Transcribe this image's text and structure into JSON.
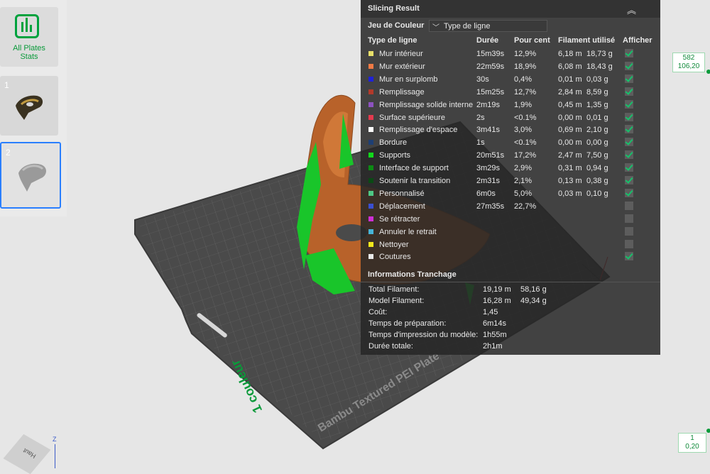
{
  "sidebar": {
    "stats_label_line1": "All Plates",
    "stats_label_line2": "Stats",
    "plates": [
      {
        "number": "1"
      },
      {
        "number": "2"
      }
    ]
  },
  "scene": {
    "plate_text": "Bambu Textured PEI Plate",
    "filament_label": "1 couleur",
    "axis_z": "Z",
    "axis_view": "Haut"
  },
  "panel": {
    "title": "Slicing Result",
    "color_scheme_label": "Jeu de Couleur",
    "color_scheme_value": "Type de ligne",
    "headers": {
      "type": "Type de ligne",
      "duration": "Durée",
      "percent": "Pour cent",
      "filament": "Filament utilisé",
      "show": "Afficher"
    },
    "rows": [
      {
        "name": "Mur intérieur",
        "color": "#e8e06a",
        "dur": "15m39s",
        "pct": "12,9%",
        "len": "6,18 m",
        "wt": "18,73 g",
        "shown": true
      },
      {
        "name": "Mur extérieur",
        "color": "#f07a45",
        "dur": "22m59s",
        "pct": "18,9%",
        "len": "6,08 m",
        "wt": "18,43 g",
        "shown": true
      },
      {
        "name": "Mur en surplomb",
        "color": "#1f22d8",
        "dur": "30s",
        "pct": "0,4%",
        "len": "0,01 m",
        "wt": "0,03 g",
        "shown": true
      },
      {
        "name": "Remplissage",
        "color": "#b23a2a",
        "dur": "15m25s",
        "pct": "12,7%",
        "len": "2,84 m",
        "wt": "8,59 g",
        "shown": true
      },
      {
        "name": "Remplissage solide interne",
        "color": "#8d52c0",
        "dur": "2m19s",
        "pct": "1,9%",
        "len": "0,45 m",
        "wt": "1,35 g",
        "shown": true
      },
      {
        "name": "Surface supérieure",
        "color": "#e43a4e",
        "dur": "2s",
        "pct": "<0.1%",
        "len": "0,00 m",
        "wt": "0,01 g",
        "shown": true
      },
      {
        "name": "Remplissage d'espace",
        "color": "#ffffff",
        "dur": "3m41s",
        "pct": "3,0%",
        "len": "0,69 m",
        "wt": "2,10 g",
        "shown": true
      },
      {
        "name": "Bordure",
        "color": "#1e3f74",
        "dur": "1s",
        "pct": "<0.1%",
        "len": "0,00 m",
        "wt": "0,00 g",
        "shown": true
      },
      {
        "name": "Supports",
        "color": "#11d81b",
        "dur": "20m51s",
        "pct": "17,2%",
        "len": "2,47 m",
        "wt": "7,50 g",
        "shown": true
      },
      {
        "name": "Interface de support",
        "color": "#0c8a14",
        "dur": "3m29s",
        "pct": "2,9%",
        "len": "0,31 m",
        "wt": "0,94 g",
        "shown": true
      },
      {
        "name": "Soutenir la transition",
        "color": "#0a4a14",
        "dur": "2m31s",
        "pct": "2,1%",
        "len": "0,13 m",
        "wt": "0,38 g",
        "shown": true
      },
      {
        "name": "Personnalisé",
        "color": "#4ec884",
        "dur": "6m0s",
        "pct": "5,0%",
        "len": "0,03 m",
        "wt": "0,10 g",
        "shown": true
      },
      {
        "name": "Déplacement",
        "color": "#3a4fd0",
        "dur": "27m35s",
        "pct": "22,7%",
        "len": "",
        "wt": "",
        "shown": false
      },
      {
        "name": "Se rétracter",
        "color": "#cf2fd6",
        "dur": "",
        "pct": "",
        "len": "",
        "wt": "",
        "shown": false
      },
      {
        "name": "Annuler le retrait",
        "color": "#46b4d8",
        "dur": "",
        "pct": "",
        "len": "",
        "wt": "",
        "shown": false
      },
      {
        "name": "Nettoyer",
        "color": "#f2e81c",
        "dur": "",
        "pct": "",
        "len": "",
        "wt": "",
        "shown": false
      },
      {
        "name": "Coutures",
        "color": "#e8e8e8",
        "dur": "",
        "pct": "",
        "len": "",
        "wt": "",
        "shown": true
      }
    ],
    "info_title": "Informations Tranchage",
    "info": [
      {
        "label": "Total Filament:",
        "v1": "19,19 m",
        "v2": "58,16 g"
      },
      {
        "label": "Model Filament:",
        "v1": "16,28 m",
        "v2": "49,34 g"
      },
      {
        "label": "Coût:",
        "v1": "1,45",
        "v2": ""
      },
      {
        "label": "Temps de préparation:",
        "v1": "6m14s",
        "v2": ""
      },
      {
        "label": "Temps d'impression du modèle:",
        "v1": "1h55m",
        "v2": ""
      },
      {
        "label": "Durée totale:",
        "v1": "2h1m",
        "v2": ""
      }
    ]
  },
  "layer_slider": {
    "top_layer": "582",
    "top_height": "106,20",
    "bottom_layer": "1",
    "bottom_height": "0,20"
  }
}
